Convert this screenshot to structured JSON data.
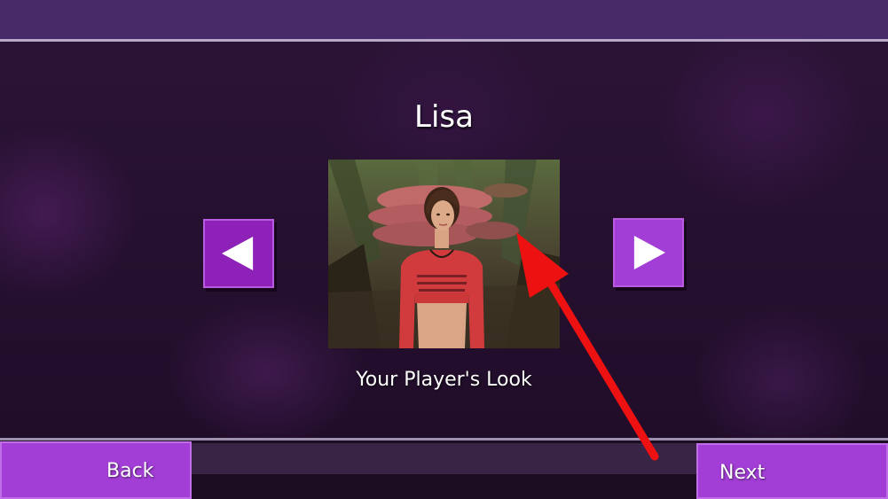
{
  "character": {
    "name": "Lisa",
    "caption": "Your Player's Look"
  },
  "navigation": {
    "back_label": "Back",
    "next_label": "Next",
    "prev_icon": "triangle-left-icon",
    "next_icon": "triangle-right-icon"
  },
  "colors": {
    "accent": "#a23ed6",
    "top_bar": "#472a67",
    "annotation": "#ee1111"
  }
}
